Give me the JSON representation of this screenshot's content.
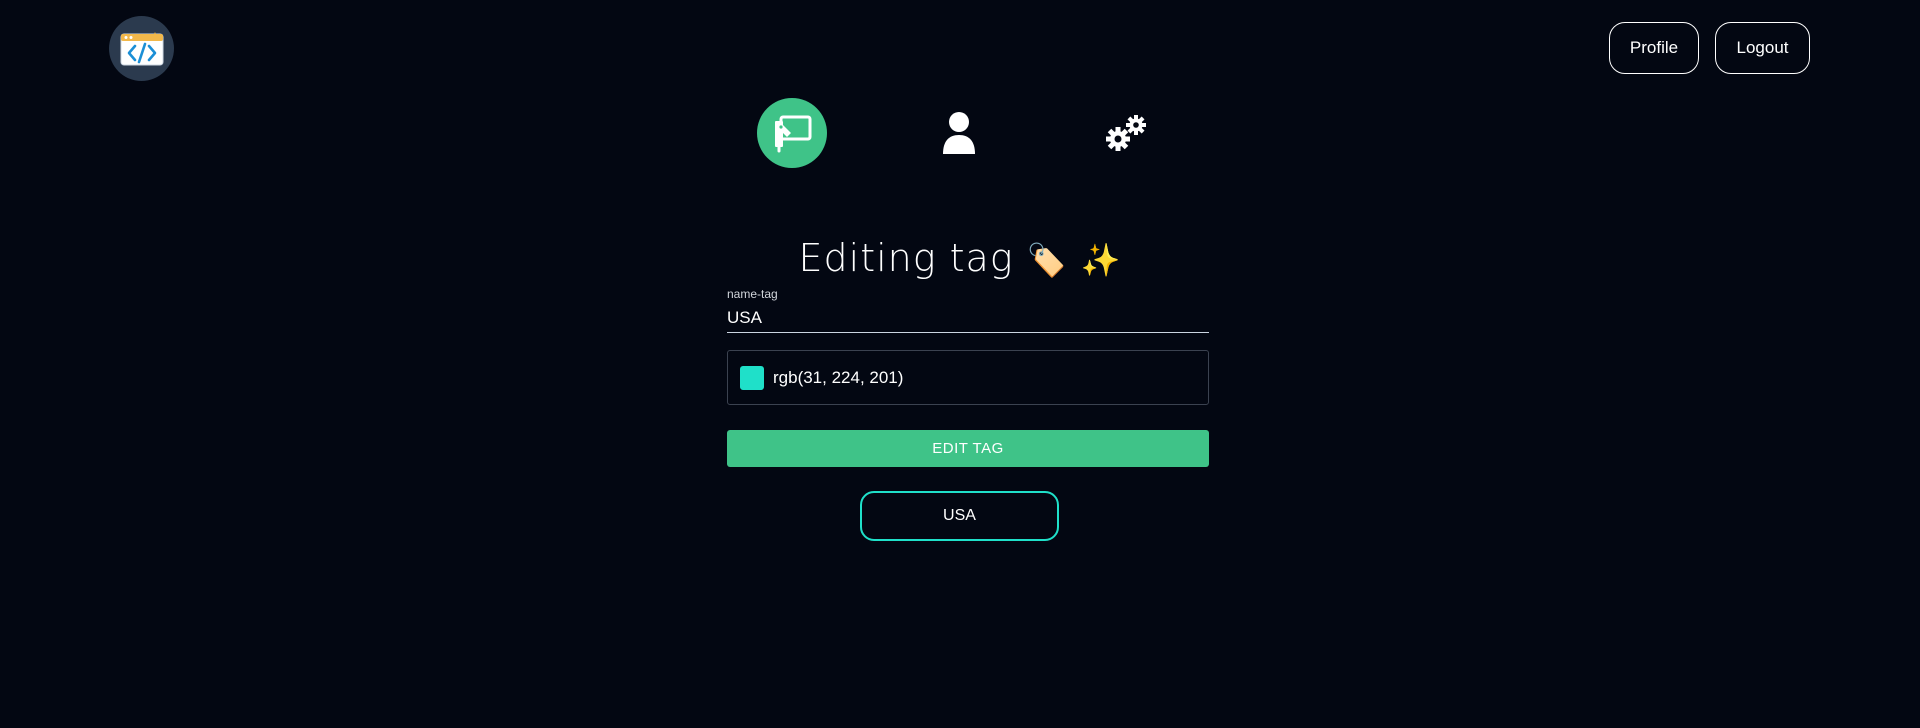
{
  "header": {
    "logo_icon": "code-window-icon",
    "profile_label": "Profile",
    "logout_label": "Logout"
  },
  "icon_nav": [
    {
      "icon": "tag-board-icon",
      "active": true
    },
    {
      "icon": "user-icon",
      "active": false
    },
    {
      "icon": "gears-icon",
      "active": false
    }
  ],
  "form": {
    "title": "Editing tag",
    "title_emoji_1": "🏷️",
    "title_emoji_2": "✨",
    "name_label": "name-tag",
    "name_value": "USA",
    "color_value": "rgb(31, 224, 201)",
    "submit_label": "EDIT TAG"
  },
  "preview": {
    "tag_label": "USA"
  },
  "colors": {
    "background": "#030712",
    "accent": "#3fc388",
    "tag_color": "#1fe0c9"
  }
}
